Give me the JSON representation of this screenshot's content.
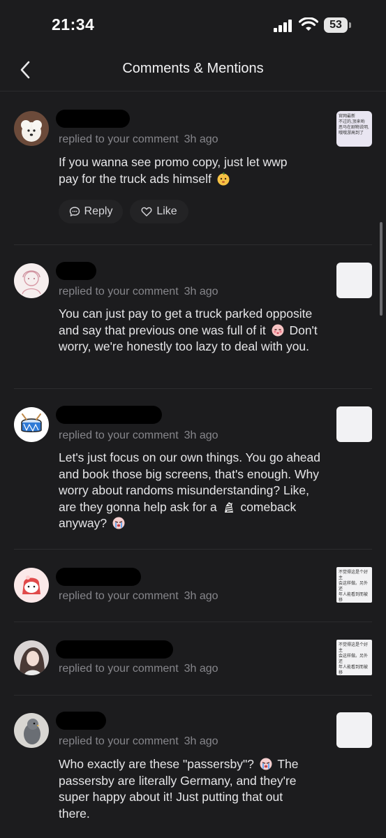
{
  "status_bar": {
    "time": "21:34",
    "battery": "53",
    "icons": [
      "signal-icon",
      "wifi-icon",
      "battery-icon"
    ]
  },
  "nav": {
    "title": "Comments & Mentions",
    "back_icon": "chevron-left-icon"
  },
  "items": [
    {
      "avatar": "white-dog-avatar",
      "action_text": "replied to your comment",
      "time": "3h ago",
      "text": "If you wanna see promo copy, just let wwp pay for the truck ads himself",
      "emoji": "pear-face-emoji",
      "thumbnail_text": "官网最新\n不过的,顶来哟\n恶马在剧物说明,\n哦哦游高到了",
      "actions": {
        "reply_label": "Reply",
        "like_label": "Like"
      }
    },
    {
      "avatar": "sketch-girl-avatar",
      "action_text": "replied to your comment",
      "time": "3h ago",
      "text_before": "You can just pay to get a truck parked opposite and say that previous one was full of it",
      "emoji": "blushing-face-emoji",
      "text_after": "Don't worry, we're honestly too lazy to deal with you."
    },
    {
      "avatar": "drum-avatar",
      "action_text": "replied to your comment",
      "time": "3h ago",
      "text_before": "Let's just focus on our own things. You go ahead and book those big screens, that's enough. Why worry about randoms misunderstanding? Like, are they gonna help ask for a",
      "emoji_mid": "zebra-emoji",
      "text_after": "comeback anyway?",
      "emoji_end": "crying-face-emoji"
    },
    {
      "avatar": "red-mask-avatar",
      "action_text": "replied to your comment",
      "time": "3h ago",
      "thumbnail_text": "不觉得这是个好主\n会这样做。另外还\n年人能看到而被移\n\n查看原文"
    },
    {
      "avatar": "woman-avatar",
      "action_text": "replied to your comment",
      "time": "3h ago",
      "thumbnail_text": "不觉得这是个好主\n会这样做。另外还\n年人能看到而被移\n\n查看原文"
    },
    {
      "avatar": "bird-avatar",
      "action_text": "replied to your comment",
      "time": "3h ago",
      "text_before": "Who exactly are these \"passersby\"?",
      "emoji": "crying-face-emoji",
      "text_after": "The passersby are literally Germany, and they're super happy about it! Just putting that out there."
    }
  ],
  "colors": {
    "background": "#1c1c1e",
    "secondary_text": "#86868b",
    "primary_text": "#e6e6e8"
  }
}
